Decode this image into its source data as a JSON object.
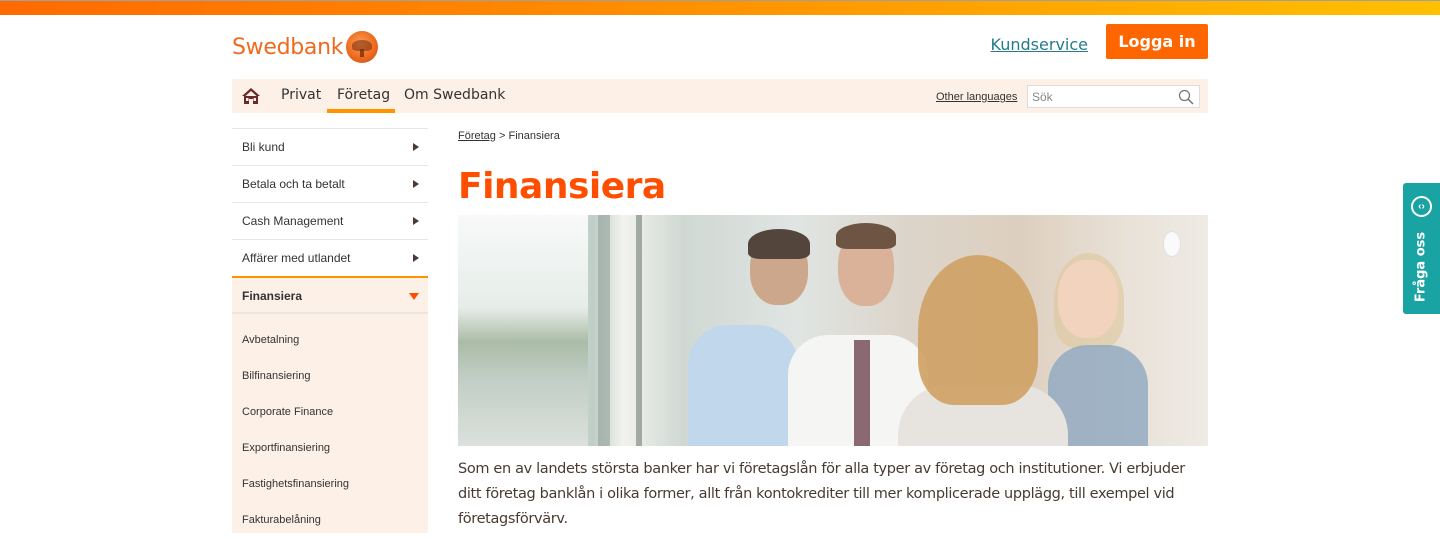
{
  "brand": {
    "name": "Swedbank",
    "colors": {
      "primary_orange": "#ff6600",
      "title_orange": "#ff4e00",
      "nav_accent": "#ff9300",
      "nav_bg": "#fdf0e7",
      "teal": "#1aa3a3",
      "link_teal": "#257b8a"
    }
  },
  "header": {
    "kundservice_label": "Kundservice",
    "login_label": "Logga in"
  },
  "nav": {
    "home_icon": "home-icon",
    "items": [
      {
        "label": "Privat",
        "active": false
      },
      {
        "label": "Företag",
        "active": true
      },
      {
        "label": "Om Swedbank",
        "active": false
      }
    ],
    "other_languages": "Other languages",
    "search": {
      "placeholder": "Sök",
      "value": "",
      "icon": "search-icon"
    }
  },
  "sidebar": {
    "items": [
      {
        "label": "Bli kund",
        "icon": "chevron-right-icon"
      },
      {
        "label": "Betala och ta betalt",
        "icon": "chevron-right-icon"
      },
      {
        "label": "Cash Management",
        "icon": "chevron-right-icon"
      },
      {
        "label": "Affärer med utlandet",
        "icon": "chevron-right-icon"
      }
    ],
    "active": {
      "label": "Finansiera",
      "icon": "chevron-down-icon"
    },
    "subitems": [
      {
        "label": "Avbetalning"
      },
      {
        "label": "Bilfinansiering"
      },
      {
        "label": "Corporate Finance"
      },
      {
        "label": "Exportfinansiering"
      },
      {
        "label": "Fastighetsfinansiering"
      },
      {
        "label": "Fakturabelåning"
      }
    ]
  },
  "main": {
    "breadcrumb": {
      "parent": "Företag",
      "separator": ">",
      "current": "Finansiera"
    },
    "title": "Finansiera",
    "hero_alt": "Fyra kollegor i samtal vid ett fönster",
    "intro": "Som en av landets största banker har vi företagslån för alla typer av företag och institutioner. Vi erbjuder ditt företag banklån i olika former, allt från kontokrediter till mer komplicerade upplägg, till exempel vid företagsförvärv."
  },
  "chat": {
    "label": "Fråga oss",
    "icon": "chat-icon",
    "icon_glyph": "‹›"
  }
}
